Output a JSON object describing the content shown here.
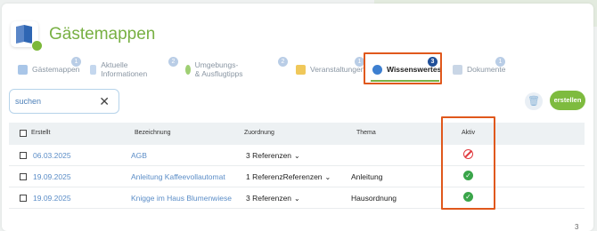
{
  "app": {
    "title": "Gästemappen"
  },
  "tabs": [
    {
      "label": "Gästemappen",
      "badge": "1"
    },
    {
      "label": "Aktuelle Informationen",
      "badge": "2"
    },
    {
      "label": "Umgebungs- & Ausflugtipps",
      "badge": "2"
    },
    {
      "label": "Veranstaltungen",
      "badge": "1"
    },
    {
      "label": "Wissenswertes",
      "badge": "3",
      "active": true
    },
    {
      "label": "Dokumente",
      "badge": "1"
    }
  ],
  "search": {
    "placeholder": "suchen"
  },
  "toolbar": {
    "create_label": "erstellen"
  },
  "table": {
    "headers": {
      "created": "Erstellt",
      "name": "Bezeichnung",
      "assignment": "Zuordnung",
      "topic": "Thema",
      "active": "Aktiv"
    },
    "rows": [
      {
        "created": "06.03.2025",
        "name": "AGB",
        "assignment": "3 Referenzen",
        "topic": "",
        "active": false
      },
      {
        "created": "19.09.2025",
        "name": "Anleitung Kaffeevollautomat",
        "assignment": "1 ReferenzReferenzen",
        "topic": "Anleitung",
        "active": true
      },
      {
        "created": "19.09.2025",
        "name": "Knigge im Haus Blumenwiese",
        "assignment": "3 Referenzen",
        "topic": "Hausordnung",
        "active": true
      }
    ]
  },
  "page_number": "3",
  "colors": {
    "brand_green": "#78b043",
    "link_blue": "#5b8dc7",
    "highlight": "#e0581c",
    "active_badge": "#1f4f99"
  }
}
